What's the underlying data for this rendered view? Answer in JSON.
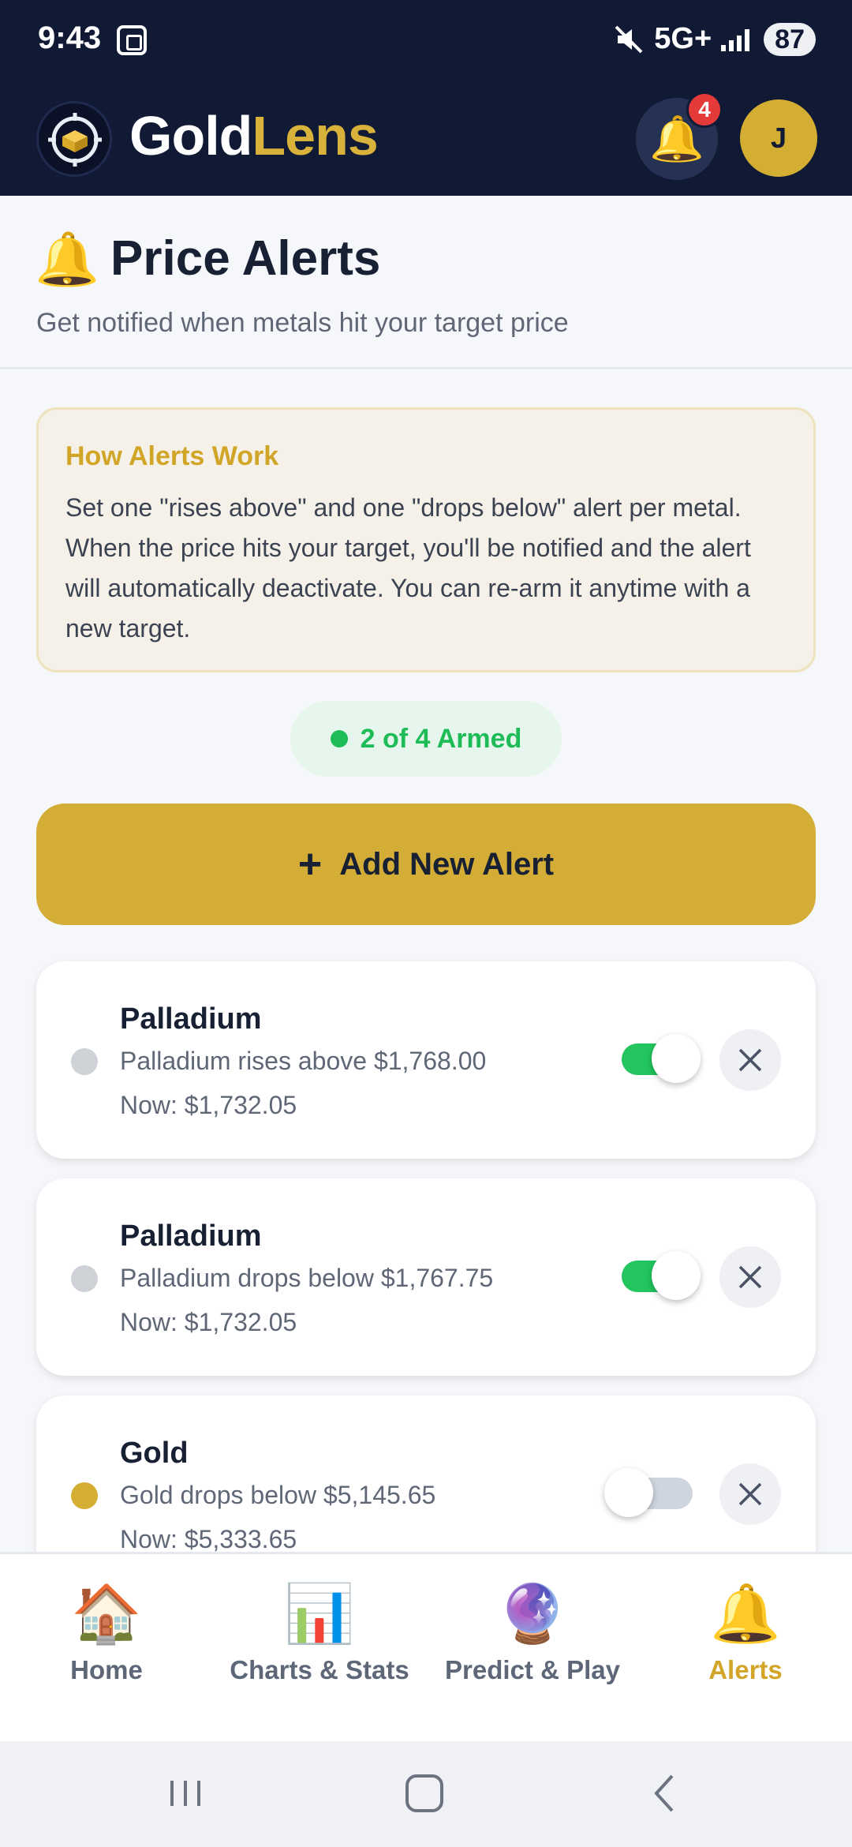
{
  "status_bar": {
    "time": "9:43",
    "network": "5G+",
    "battery": "87"
  },
  "header": {
    "brand_part1": "Gold",
    "brand_part2": "Lens",
    "notification_count": "4",
    "avatar_initial": "J",
    "brand_color": "#d8b23a"
  },
  "page": {
    "title": "Price Alerts",
    "subtitle": "Get notified when metals hit your target price"
  },
  "info_box": {
    "title": "How Alerts Work",
    "body": "Set one \"rises above\" and one \"drops below\" alert per metal. When the price hits your target, you'll be notified and the alert will automatically deactivate. You can re-arm it anytime with a new target."
  },
  "armed_status": "2 of 4 Armed",
  "add_button": {
    "icon": "+",
    "label": "Add New Alert"
  },
  "alerts": [
    {
      "metal": "Palladium",
      "description": "Palladium rises above $1,768.00",
      "now": "Now: $1,732.05",
      "enabled": true,
      "dot_color": "#cfd2d6"
    },
    {
      "metal": "Palladium",
      "description": "Palladium drops below $1,767.75",
      "now": "Now: $1,732.05",
      "enabled": true,
      "dot_color": "#cfd2d6"
    },
    {
      "metal": "Gold",
      "description": "Gold drops below $5,145.65",
      "now": "Now: $5,333.65",
      "enabled": false,
      "dot_color": "#d4ad33"
    }
  ],
  "bottom_nav": [
    {
      "label": "Home",
      "icon": "house-icon",
      "active": false
    },
    {
      "label": "Charts & Stats",
      "icon": "bar-chart-icon",
      "active": false
    },
    {
      "label": "Predict & Play",
      "icon": "crystal-ball-icon",
      "active": false
    },
    {
      "label": "Alerts",
      "icon": "bell-icon",
      "active": true
    }
  ]
}
